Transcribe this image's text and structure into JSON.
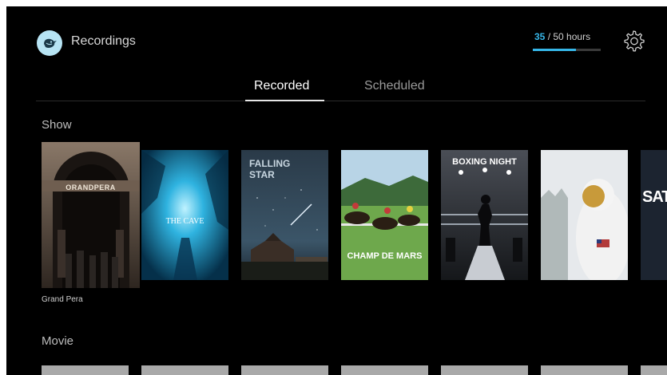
{
  "app": {
    "title": "Recordings",
    "logo_icon": "bird-logo-icon",
    "accent_color": "#36b6e8"
  },
  "storage": {
    "used": "35",
    "separator": " / ",
    "total": "50 hours",
    "fraction": 0.64
  },
  "tabs": [
    {
      "label": "Recorded",
      "active": true
    },
    {
      "label": "Scheduled",
      "active": false
    }
  ],
  "sections": [
    {
      "title": "Show",
      "focused_caption": "Grand Pera",
      "items": [
        {
          "title": "ORANDPERA"
        },
        {
          "title": "THE CAVE"
        },
        {
          "title": "FALLING STAR"
        },
        {
          "title": "CHAMP DE MARS"
        },
        {
          "title": "BOXING NIGHT"
        },
        {
          "title": ""
        },
        {
          "title": "SATU"
        }
      ]
    },
    {
      "title": "Movie"
    }
  ]
}
